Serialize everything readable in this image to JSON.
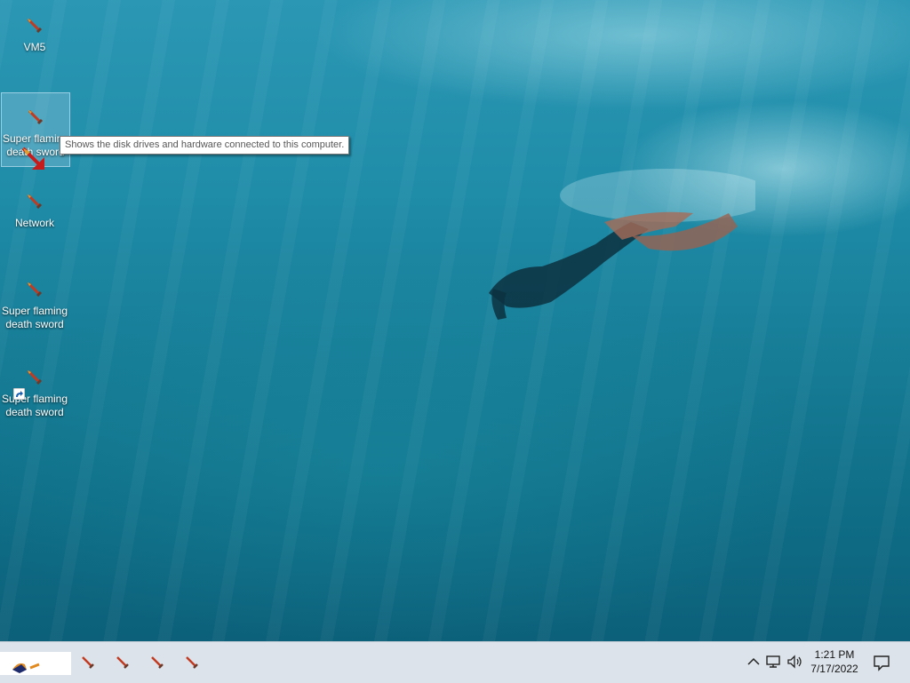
{
  "desktop": {
    "icons": [
      {
        "label": "VM5",
        "icon": "sword-icon"
      },
      {
        "label": "Super flaming death sword",
        "icon": "sword-icon",
        "selected": true
      },
      {
        "label": "Network",
        "icon": "sword-icon"
      },
      {
        "label": "Super flaming death sword",
        "icon": "sword-icon"
      },
      {
        "label": "Super flaming death sword",
        "icon": "sword-icon",
        "shortcut": true
      }
    ],
    "tooltip": "Shows the disk drives and hardware connected to this computer."
  },
  "taskbar": {
    "pinned": [
      "sword-icon",
      "sword-icon",
      "sword-icon",
      "sword-icon"
    ],
    "tray_icons": [
      "chevron-up-icon",
      "network-icon",
      "volume-icon"
    ],
    "time": "1:21 PM",
    "date": "7/17/2022",
    "notification_icon": "notification-icon"
  },
  "colors": {
    "water": "#1f8ca8",
    "taskbar": "#dce3ea",
    "tooltip_border": "#767676"
  }
}
